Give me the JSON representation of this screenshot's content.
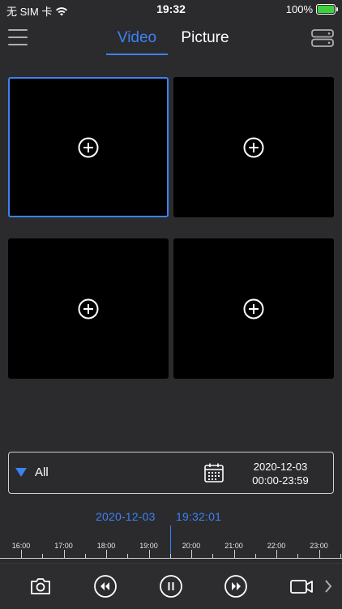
{
  "status_bar": {
    "carrier": "无 SIM 卡",
    "time": "19:32",
    "battery_percent": "100%",
    "battery_level": 1.0
  },
  "nav": {
    "tabs": [
      {
        "label": "Video",
        "active": true
      },
      {
        "label": "Picture",
        "active": false
      }
    ]
  },
  "grid": {
    "cells": [
      {
        "selected": true
      },
      {
        "selected": false
      },
      {
        "selected": false
      },
      {
        "selected": false
      }
    ]
  },
  "filter": {
    "selected_option": "All",
    "date": "2020-12-03",
    "time_range": "00:00-23:59"
  },
  "timeline": {
    "current_date": "2020-12-03",
    "current_time": "19:32:01",
    "labels": [
      "16:00",
      "17:00",
      "18:00",
      "19:00",
      "20:00",
      "21:00",
      "22:00",
      "23:00"
    ]
  },
  "colors": {
    "accent": "#3b82f6",
    "background": "#2b2b2d",
    "cell": "#000000"
  },
  "icons": {
    "menu": "hamburger-icon",
    "storage": "storage-icon",
    "add": "plus-circle-icon",
    "calendar": "calendar-icon",
    "snapshot": "camera-icon",
    "rewind": "rewind-icon",
    "pause": "pause-icon",
    "fast_forward": "fast-forward-icon",
    "record": "video-record-icon",
    "more": "chevron-right-icon"
  }
}
